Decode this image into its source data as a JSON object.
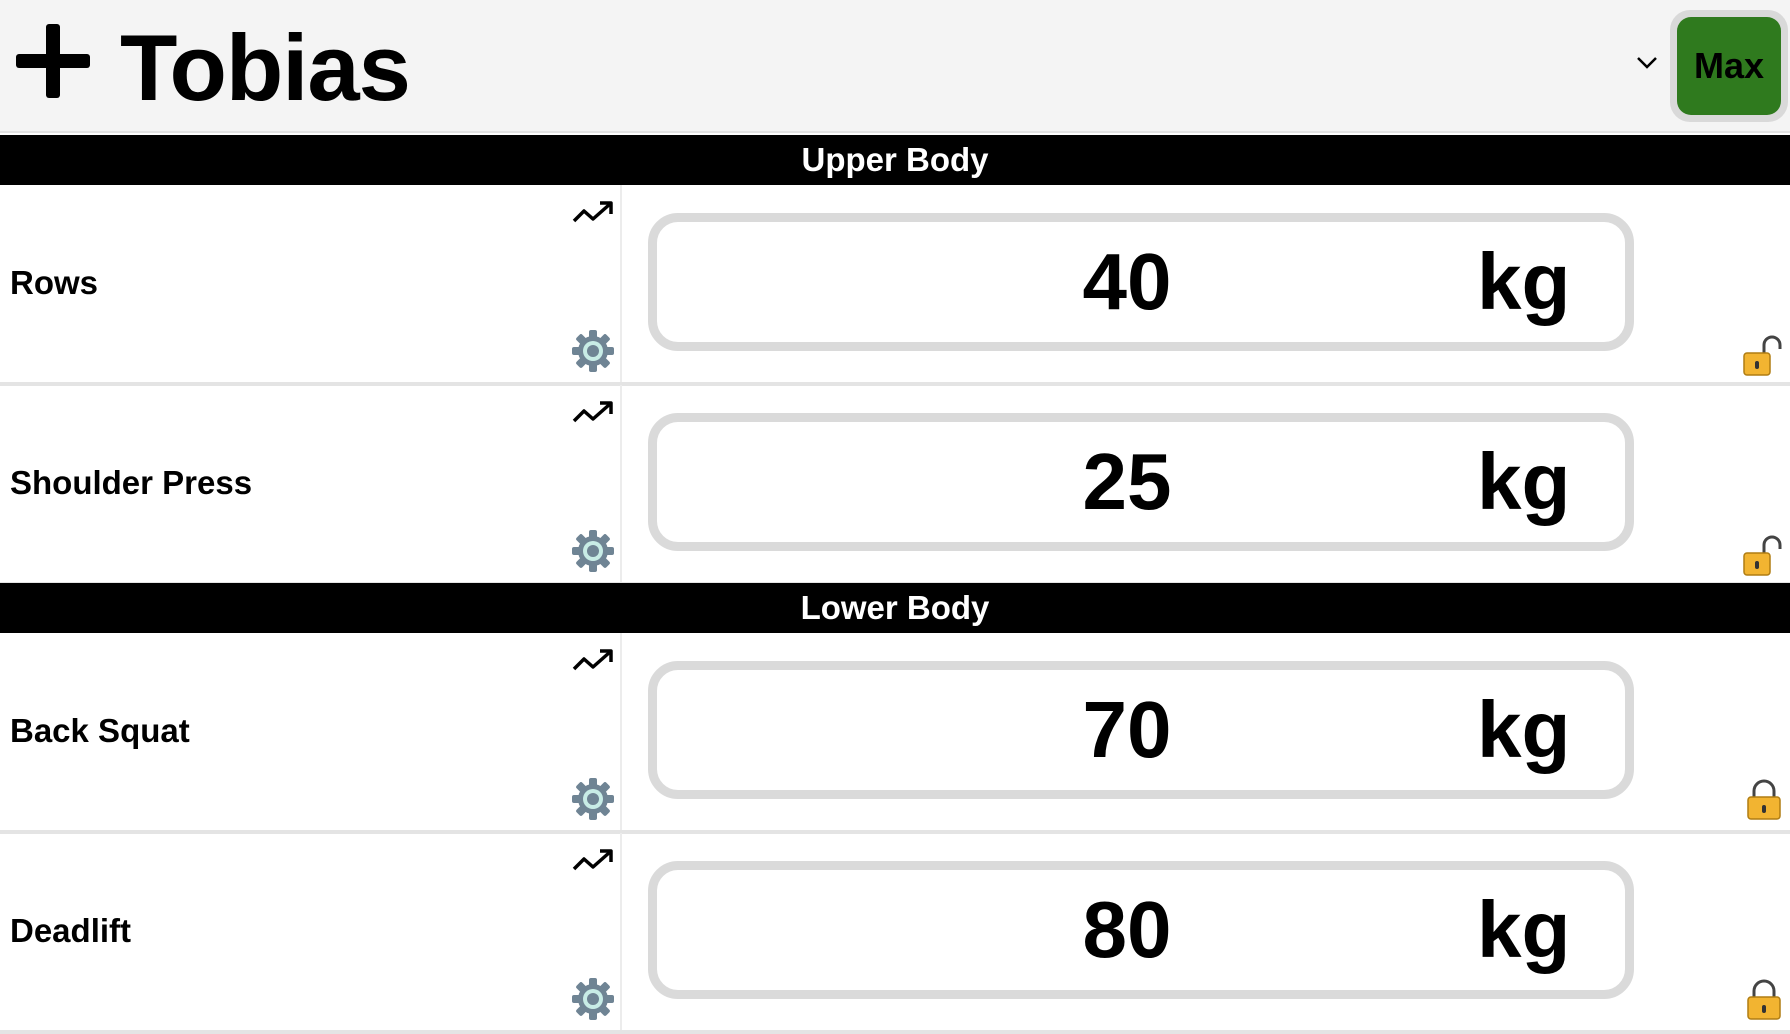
{
  "header": {
    "add_icon": "plus-icon",
    "user_name": "Tobias",
    "dropdown_icon": "chevron-down-icon",
    "max_button_label": "Max",
    "max_button_color": "#2f7a1e"
  },
  "sections": [
    {
      "title": "Upper Body",
      "exercises": [
        {
          "name": "Rows",
          "value": "40",
          "unit": "kg",
          "locked": false
        },
        {
          "name": "Shoulder Press",
          "value": "25",
          "unit": "kg",
          "locked": false
        }
      ]
    },
    {
      "title": "Lower Body",
      "exercises": [
        {
          "name": "Back Squat",
          "value": "70",
          "unit": "kg",
          "locked": true
        },
        {
          "name": "Deadlift",
          "value": "80",
          "unit": "kg",
          "locked": true
        }
      ]
    }
  ],
  "icons": {
    "trend": "trending-up-icon",
    "settings": "gear-icon",
    "unlocked": "unlocked-padlock-icon",
    "locked": "locked-padlock-icon"
  },
  "colors": {
    "section_header_bg": "#000000",
    "lock_gold": "#f2b431"
  }
}
